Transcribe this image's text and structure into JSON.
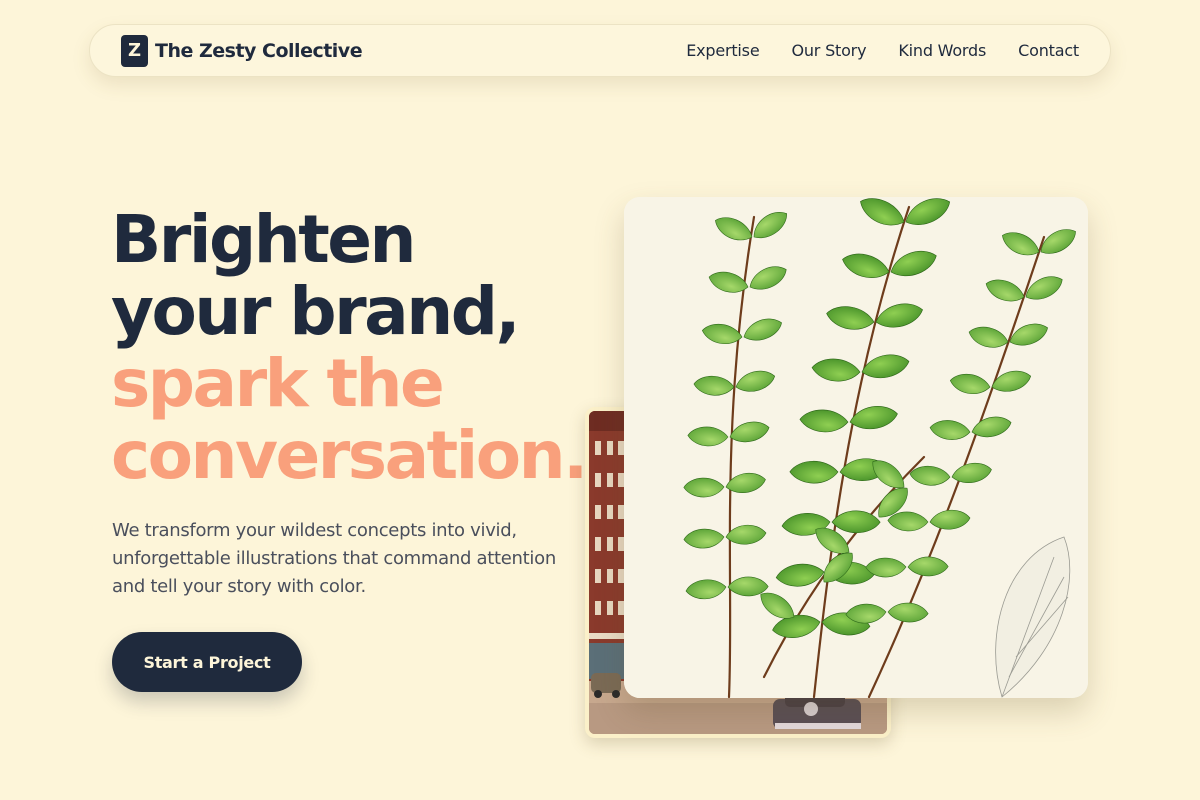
{
  "nav": {
    "logo_letter": "Z",
    "brand_name": "The Zesty Collective",
    "links": [
      "Expertise",
      "Our Story",
      "Kind Words",
      "Contact"
    ]
  },
  "hero": {
    "headline_line1": "Brighten",
    "headline_line2": "your brand,",
    "headline_line3": "spark the",
    "headline_line4": "conversation.",
    "subtext": "We transform your wildest concepts into vivid, unforgettable illustrations that command attention and tell your story with color.",
    "cta_label": "Start a Project"
  },
  "images": {
    "front_image": "fern-botanical-illustration",
    "back_image": "vintage-street-postcard"
  },
  "colors": {
    "background": "#fdf5d9",
    "dark": "#1f2a3d",
    "accent": "#f9a07c"
  }
}
